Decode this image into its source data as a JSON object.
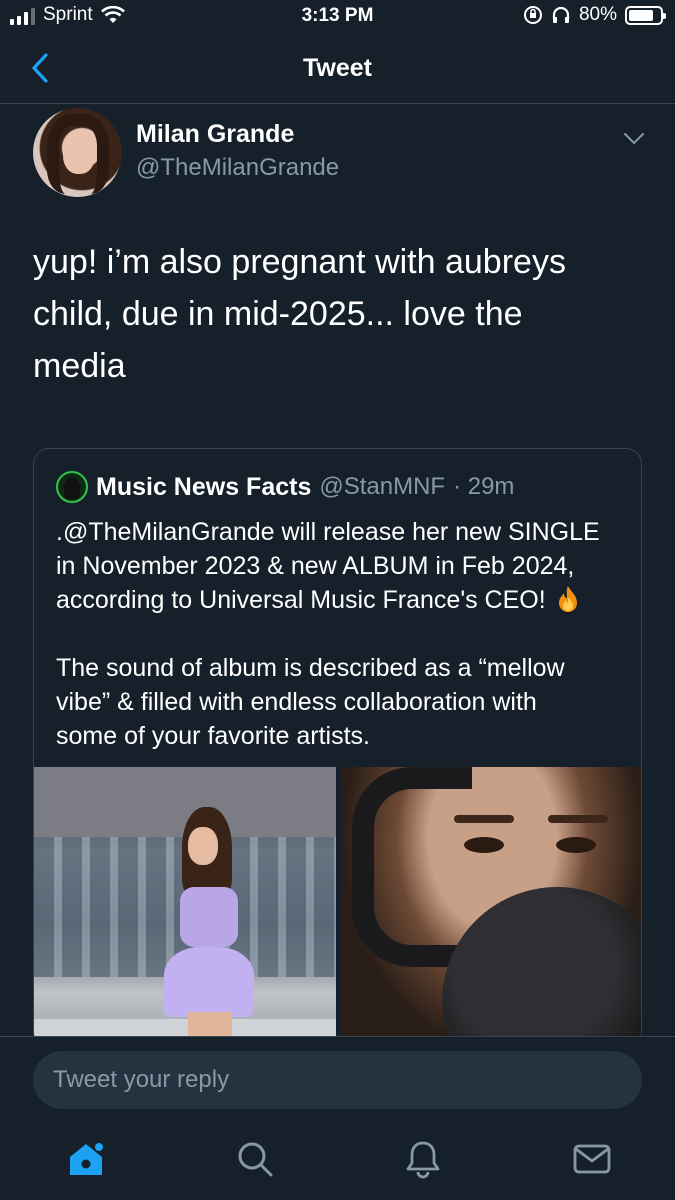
{
  "status_bar": {
    "carrier": "Sprint",
    "time": "3:13 PM",
    "battery_percent": "80%",
    "battery_level": 0.8
  },
  "nav": {
    "title": "Tweet",
    "back_icon": "chevron-left-icon"
  },
  "tweet": {
    "author_name": "Milan Grande",
    "author_handle": "@TheMilanGrande",
    "text_lines": [
      "yup! i’m also pregnant with aubreys",
      "child, due in mid-2025... love the",
      "media"
    ]
  },
  "quote": {
    "author_name": "Music News Facts",
    "author_handle": "@StanMNF",
    "time": "· 29m",
    "paragraph1": [
      ".@TheMilanGrande will release her new SINGLE",
      "in November 2023 & new ALBUM in Feb 2024,",
      "according to Universal Music France's CEO!"
    ],
    "paragraph2": [
      "The sound of album is described as a “mellow",
      "vibe” & filled with endless collaboration with",
      "some of your favorite artists."
    ]
  },
  "reply": {
    "placeholder": "Tweet your reply"
  },
  "tab_bar": {
    "items": [
      "home-icon",
      "search-icon",
      "notifications-icon",
      "messages-icon"
    ],
    "active": "home-icon"
  },
  "colors": {
    "background": "#15202b",
    "accent": "#1da1f2",
    "muted_text": "#8899a6",
    "border": "#38444d"
  }
}
